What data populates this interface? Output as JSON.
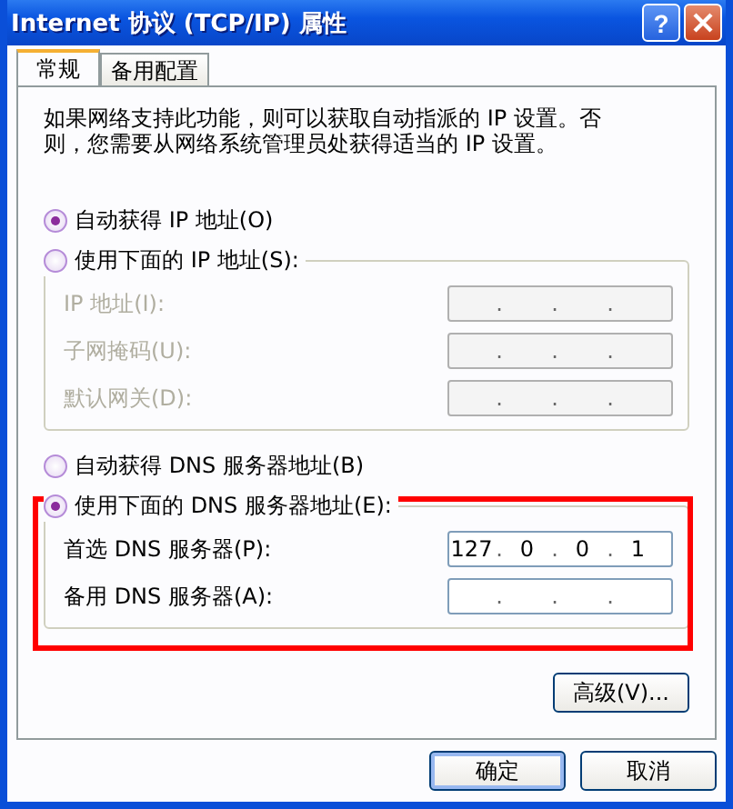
{
  "window": {
    "title": "Internet 协议 (TCP/IP) 属性",
    "help": "?"
  },
  "tabs": [
    {
      "label": "常规",
      "selected": true
    },
    {
      "label": "备用配置",
      "selected": false
    }
  ],
  "description": "如果网络支持此功能，则可以获取自动指派的 IP 设置。否则，您需要从网络系统管理员处获得适当的 IP 设置。",
  "separator": ".",
  "sections": [
    {
      "highlighted": false,
      "options": [
        {
          "label": "自动获得 IP 地址(O)",
          "selected": true
        },
        {
          "label": "使用下面的 IP 地址(S):",
          "selected": false
        }
      ],
      "fields": [
        {
          "label": "IP 地址(I):",
          "disabled": true
        },
        {
          "label": "子网掩码(U):",
          "disabled": true
        },
        {
          "label": "默认网关(D):",
          "disabled": true
        }
      ]
    },
    {
      "highlighted": true,
      "options": [
        {
          "label": "自动获得 DNS 服务器地址(B)",
          "selected": false
        },
        {
          "label": "使用下面的 DNS 服务器地址(E):",
          "selected": true
        }
      ],
      "fields": [
        {
          "label": "首选 DNS 服务器(P):",
          "disabled": false,
          "octets": [
            "127",
            "0",
            "0",
            "1"
          ]
        },
        {
          "label": "备用 DNS 服务器(A):",
          "disabled": false
        }
      ]
    }
  ],
  "advanced_button": "高级(V)...",
  "buttons": [
    {
      "label": "确定",
      "default": true
    },
    {
      "label": "取消",
      "default": false
    }
  ]
}
